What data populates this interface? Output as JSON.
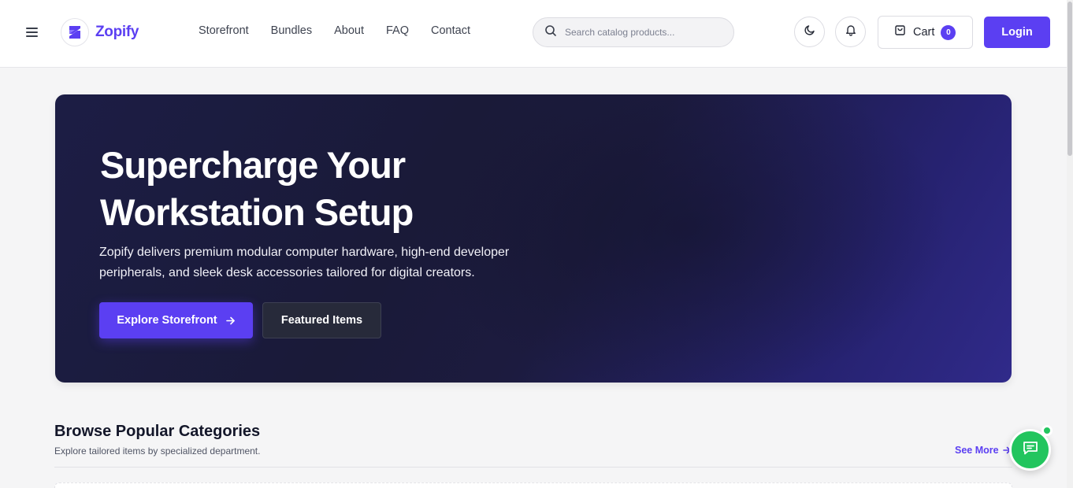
{
  "brand": {
    "name": "Zopify",
    "accent": "#5b3ff2",
    "logo_icon": "zopify-logo-icon"
  },
  "nav": {
    "items": [
      {
        "label": "Storefront"
      },
      {
        "label": "Bundles"
      },
      {
        "label": "About"
      },
      {
        "label": "FAQ"
      },
      {
        "label": "Contact"
      }
    ]
  },
  "search": {
    "placeholder": "Search catalog products...",
    "value": "",
    "icon": "search-icon"
  },
  "actions": {
    "theme_icon": "moon-icon",
    "notification_icon": "bell-icon",
    "cart_label": "Cart",
    "cart_count": "0",
    "cart_icon": "shopping-bag-icon",
    "login_label": "Login"
  },
  "hero": {
    "title": "Supercharge Your Workstation Setup",
    "description": "Zopify delivers premium modular computer hardware, high-end developer peripherals, and sleek desk accessories tailored for digital creators.",
    "primary_cta": "Explore Storefront",
    "secondary_cta": "Featured Items"
  },
  "categories": {
    "title": "Browse Popular Categories",
    "subtitle": "Explore tailored items by specialized department.",
    "see_more": "See More"
  },
  "chat": {
    "icon": "chat-bubble-icon",
    "status_color": "#22c55e"
  }
}
